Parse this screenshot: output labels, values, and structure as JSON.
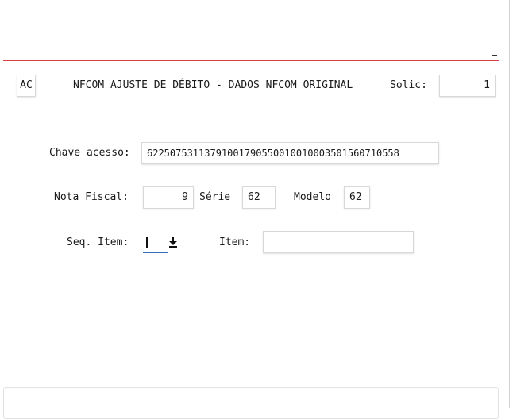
{
  "header": {
    "mode_code": "AC",
    "title": "NFCOM AJUSTE DE DÉBITO - DADOS NFCOM ORIGINAL",
    "solic_label": "Solic:",
    "solic_value": "1"
  },
  "form": {
    "chave_label": "Chave acesso:",
    "chave_value": "62250753113791001790550010010003501560710558",
    "nota_label": "Nota Fiscal:",
    "nota_value": "9",
    "serie_label": "Série",
    "serie_value": "62",
    "modelo_label": "Modelo",
    "modelo_value": "62",
    "seq_label": "Seq. Item:",
    "seq_value": "",
    "seq_icon": "download-arrow-icon",
    "item_label": "Item:",
    "item_value": ""
  },
  "colors": {
    "header_rule": "#d64040",
    "focus_underline": "#2f6fb6"
  }
}
